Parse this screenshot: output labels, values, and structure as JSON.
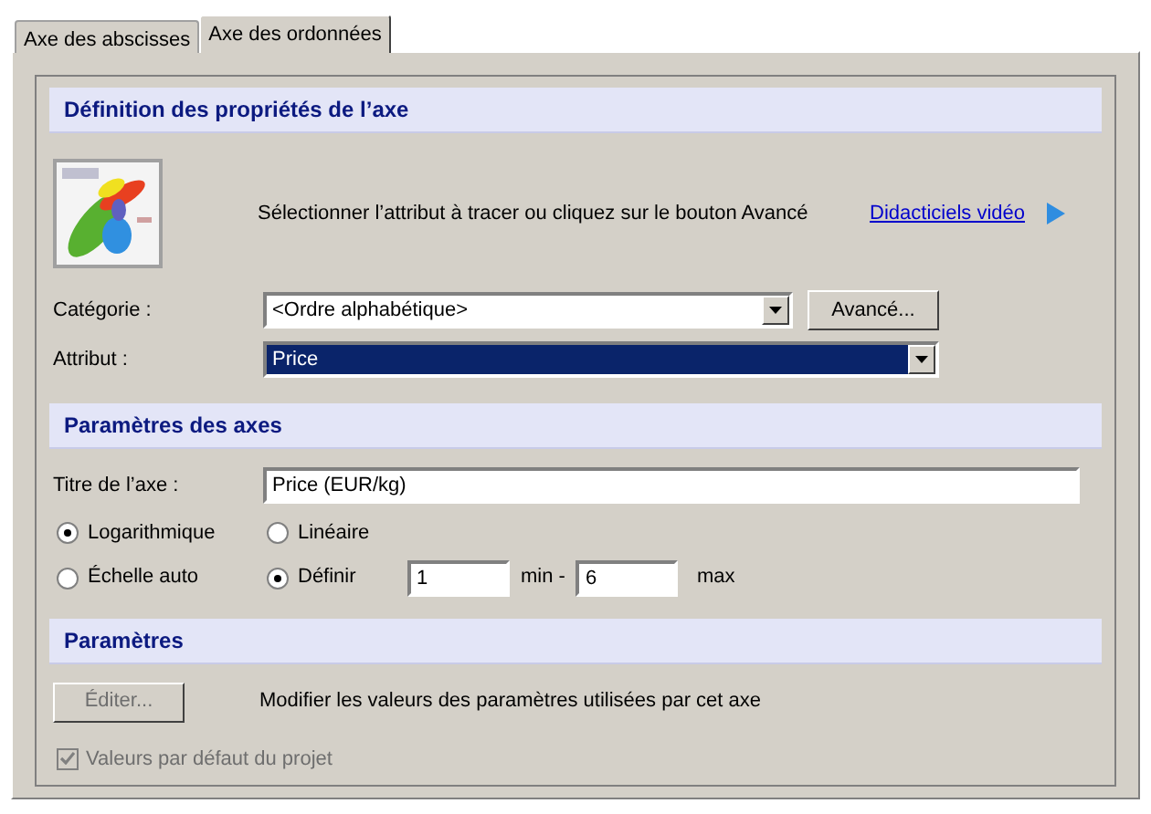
{
  "tabs": [
    {
      "label": "Axe des abscisses",
      "selected": false
    },
    {
      "label": "Axe des ordonnées",
      "selected": true
    }
  ],
  "definition": {
    "title": "Définition des propriétés de l’axe",
    "instruction": "Sélectionner l’attribut à tracer ou cliquez sur le bouton Avancé",
    "video_link": "Didacticiels vidéo",
    "category": {
      "label": "Catégorie :",
      "value": "<Ordre alphabétique>",
      "selected": false
    },
    "advanced_button": "Avancé...",
    "attribute": {
      "label": "Attribut :",
      "value": "Price",
      "selected": true
    }
  },
  "axes": {
    "title": "Paramètres des axes",
    "axis_title": {
      "label": "Titre de l’axe :",
      "value": "Price (EUR/kg)"
    },
    "scale_radios": [
      {
        "label": "Logarithmique",
        "selected": true
      },
      {
        "label": "Linéaire",
        "selected": false
      }
    ],
    "range_radios": [
      {
        "label": "Échelle auto",
        "selected": false
      },
      {
        "label": "Définir",
        "selected": true
      }
    ],
    "min": {
      "value": "1",
      "label": "min -"
    },
    "max": {
      "value": "6",
      "label": "max"
    }
  },
  "parameters": {
    "title": "Paramètres",
    "edit_button": {
      "label": "Éditer...",
      "disabled": true
    },
    "description": "Modifier les valeurs des paramètres utilisées par cet axe",
    "defaults_checkbox": {
      "label": "Valeurs par défaut du projet",
      "checked": true,
      "disabled": true
    }
  }
}
